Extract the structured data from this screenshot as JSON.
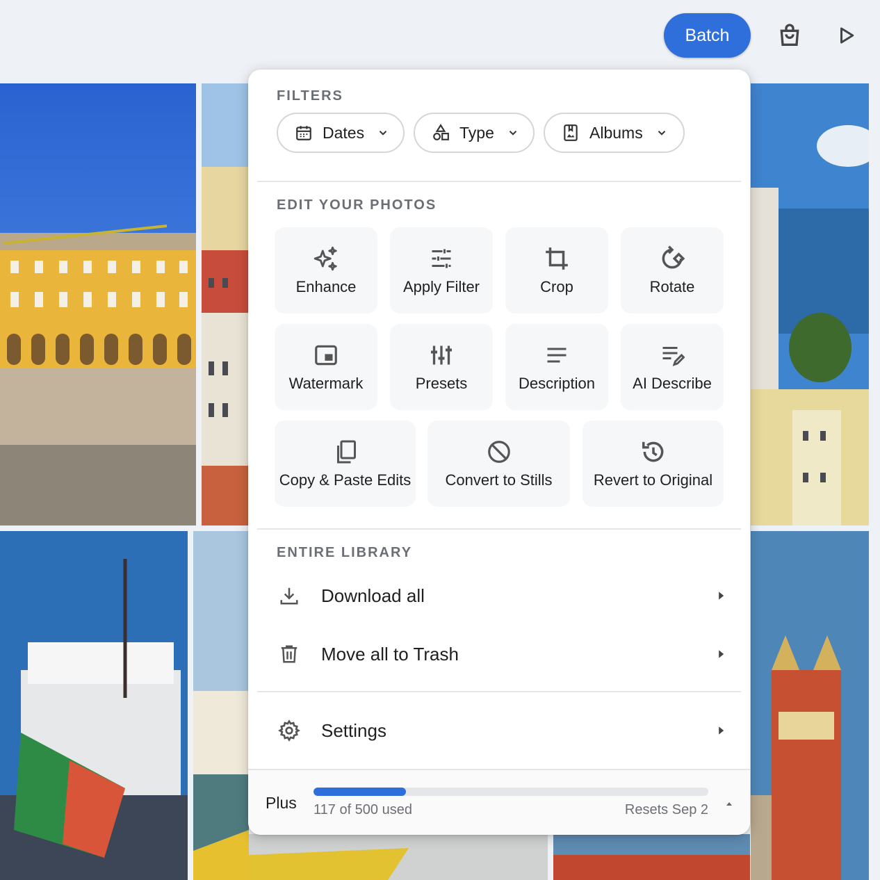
{
  "topbar": {
    "batch_label": "Batch",
    "bag_icon": "shopping-bag-icon",
    "play_icon": "play-icon",
    "accent_color": "#2f6fdc"
  },
  "filters": {
    "title": "FILTERS",
    "chips": [
      {
        "label": "Dates",
        "icon": "calendar-icon"
      },
      {
        "label": "Type",
        "icon": "shapes-icon"
      },
      {
        "label": "Albums",
        "icon": "album-icon"
      }
    ]
  },
  "edit": {
    "title": "EDIT YOUR PHOTOS",
    "tools": [
      {
        "label": "Enhance",
        "icon": "sparkle-icon"
      },
      {
        "label": "Apply Filter",
        "icon": "sliders-icon"
      },
      {
        "label": "Crop",
        "icon": "crop-icon"
      },
      {
        "label": "Rotate",
        "icon": "rotate-icon"
      },
      {
        "label": "Watermark",
        "icon": "watermark-icon"
      },
      {
        "label": "Presets",
        "icon": "presets-icon"
      },
      {
        "label": "Description",
        "icon": "text-lines-icon"
      },
      {
        "label": "AI Describe",
        "icon": "ai-describe-icon"
      },
      {
        "label": "Copy & Paste Edits",
        "icon": "copy-icon"
      },
      {
        "label": "Convert to Stills",
        "icon": "motion-off-icon"
      },
      {
        "label": "Revert to Original",
        "icon": "history-icon"
      }
    ]
  },
  "library": {
    "title": "ENTIRE LIBRARY",
    "items": [
      {
        "label": "Download all",
        "icon": "download-icon"
      },
      {
        "label": "Move all to Trash",
        "icon": "trash-icon"
      }
    ]
  },
  "settings": {
    "label": "Settings",
    "icon": "gear-icon"
  },
  "plan": {
    "name": "Plus",
    "used": 117,
    "limit": 500,
    "usage_text": "117 of 500 used",
    "resets_text": "Resets Sep 2"
  }
}
